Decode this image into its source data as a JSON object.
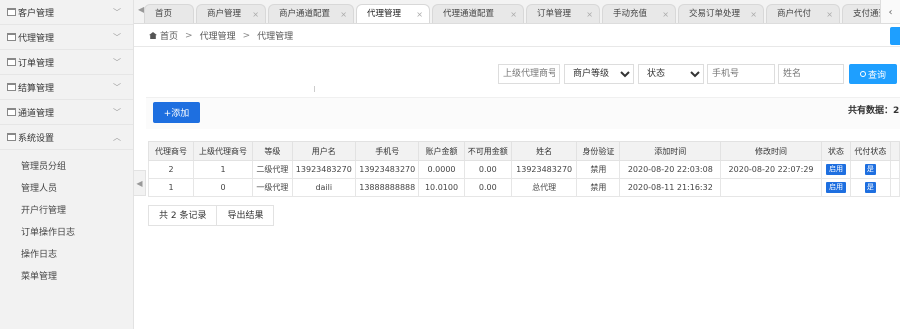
{
  "sidebar": {
    "menus": [
      {
        "label": "客户管理"
      },
      {
        "label": "代理管理"
      },
      {
        "label": "订单管理"
      },
      {
        "label": "结算管理"
      },
      {
        "label": "通道管理"
      },
      {
        "label": "系统设置"
      }
    ],
    "submenu": [
      {
        "label": "管理员分组"
      },
      {
        "label": "管理人员"
      },
      {
        "label": "开户行管理"
      },
      {
        "label": "订单操作日志"
      },
      {
        "label": "操作日志"
      },
      {
        "label": "菜单管理"
      }
    ]
  },
  "tabs": [
    {
      "label": "首页"
    },
    {
      "label": "商户管理"
    },
    {
      "label": "商户通道配置"
    },
    {
      "label": "代理管理"
    },
    {
      "label": "代理通道配置"
    },
    {
      "label": "订单管理"
    },
    {
      "label": "手动充值"
    },
    {
      "label": "交易订单处理"
    },
    {
      "label": "商户代付"
    },
    {
      "label": "支付通道"
    }
  ],
  "breadcrumb": {
    "home": "首页",
    "level1": "代理管理",
    "level2": "代理管理"
  },
  "filters": {
    "parent_placeholder": "上级代理商号",
    "level_select": "商户等级",
    "status_select": "状态",
    "phone_placeholder": "手机号",
    "name_placeholder": "姓名",
    "search_label": "查询"
  },
  "toolbar": {
    "add_label": "+添加",
    "total_label": "共有数据：2"
  },
  "table": {
    "headers": [
      "代理商号",
      "上级代理商号",
      "等级",
      "用户名",
      "手机号",
      "账户金额",
      "不可用金额",
      "姓名",
      "身份验证",
      "添加时间",
      "修改时间",
      "状态",
      "代付状态"
    ],
    "rows": [
      [
        "2",
        "1",
        "二级代理",
        "13923483270",
        "13923483270",
        "0.0000",
        "0.00",
        "13923483270",
        "禁用",
        "2020-08-20 22:03:08",
        "2020-08-20 22:07:29",
        "启用",
        "是"
      ],
      [
        "1",
        "0",
        "一级代理",
        "daili",
        "13888888888",
        "10.0100",
        "0.00",
        "总代理",
        "禁用",
        "2020-08-11 21:16:32",
        "",
        "启用",
        "是"
      ]
    ]
  },
  "pager": {
    "count": "共 2 条记录",
    "export": "导出结果"
  }
}
